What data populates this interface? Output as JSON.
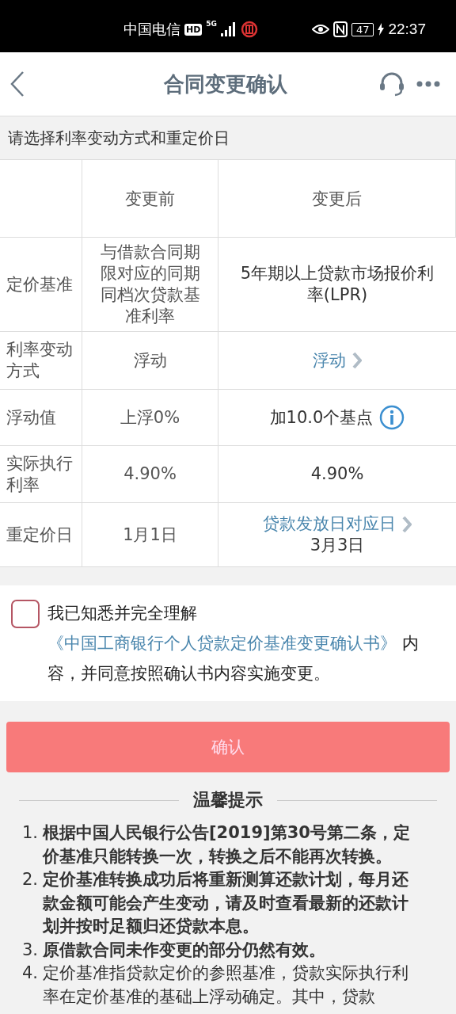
{
  "status_bar": {
    "carrier": "中国电信",
    "hd": "HD",
    "network": "5G",
    "battery": "47",
    "time": "22:37"
  },
  "header": {
    "title": "合同变更确认"
  },
  "section_label": "请选择利率变动方式和重定价日",
  "table": {
    "columns": [
      "变更前",
      "变更后"
    ],
    "rows": [
      {
        "label": "定价基准",
        "before": "与借款合同期限对应的同期同档次贷款基准利率",
        "after": "5年期以上贷款市场报价利率(LPR)",
        "kind": "plain"
      },
      {
        "label": "利率变动方式",
        "before": "浮动",
        "after": "浮动",
        "kind": "link"
      },
      {
        "label": "浮动值",
        "before": "上浮0%",
        "after": "加10.0个基点",
        "kind": "info"
      },
      {
        "label": "实际执行利率",
        "before": "4.90%",
        "after": "4.90%",
        "kind": "plain"
      },
      {
        "label": "重定价日",
        "before": "1月1日",
        "after": "贷款发放日对应日",
        "kind": "link",
        "after_note": "3月3日"
      }
    ]
  },
  "agreement": {
    "checked": false,
    "prefix": "我已知悉并完全理解",
    "link": "《中国工商银行个人贷款定价基准变更确认书》",
    "suffix": "内容，并同意按照确认书内容实施变更。"
  },
  "confirm_button": {
    "label": "确认",
    "disabled": true
  },
  "tips": {
    "title": "温馨提示",
    "items": [
      {
        "number": "1.",
        "text": "根据中国人民银行公告[2019]第30号第二条，定价基准只能转换一次，转换之后不能再次转换。",
        "emphasized": true
      },
      {
        "number": "2.",
        "text": "定价基准转换成功后将重新测算还款计划，每月还款金额可能会产生变动，请及时查看最新的还款计划并按时足额归还贷款本息。",
        "emphasized": true
      },
      {
        "number": "3.",
        "text": "原借款合同未作变更的部分仍然有效。",
        "emphasized": true
      },
      {
        "number": "4.",
        "text": "定价基准指贷款定价的参照基准，贷款实际执行利率在定价基准的基础上浮动确定。其中，贷款",
        "emphasized": false
      }
    ]
  }
}
